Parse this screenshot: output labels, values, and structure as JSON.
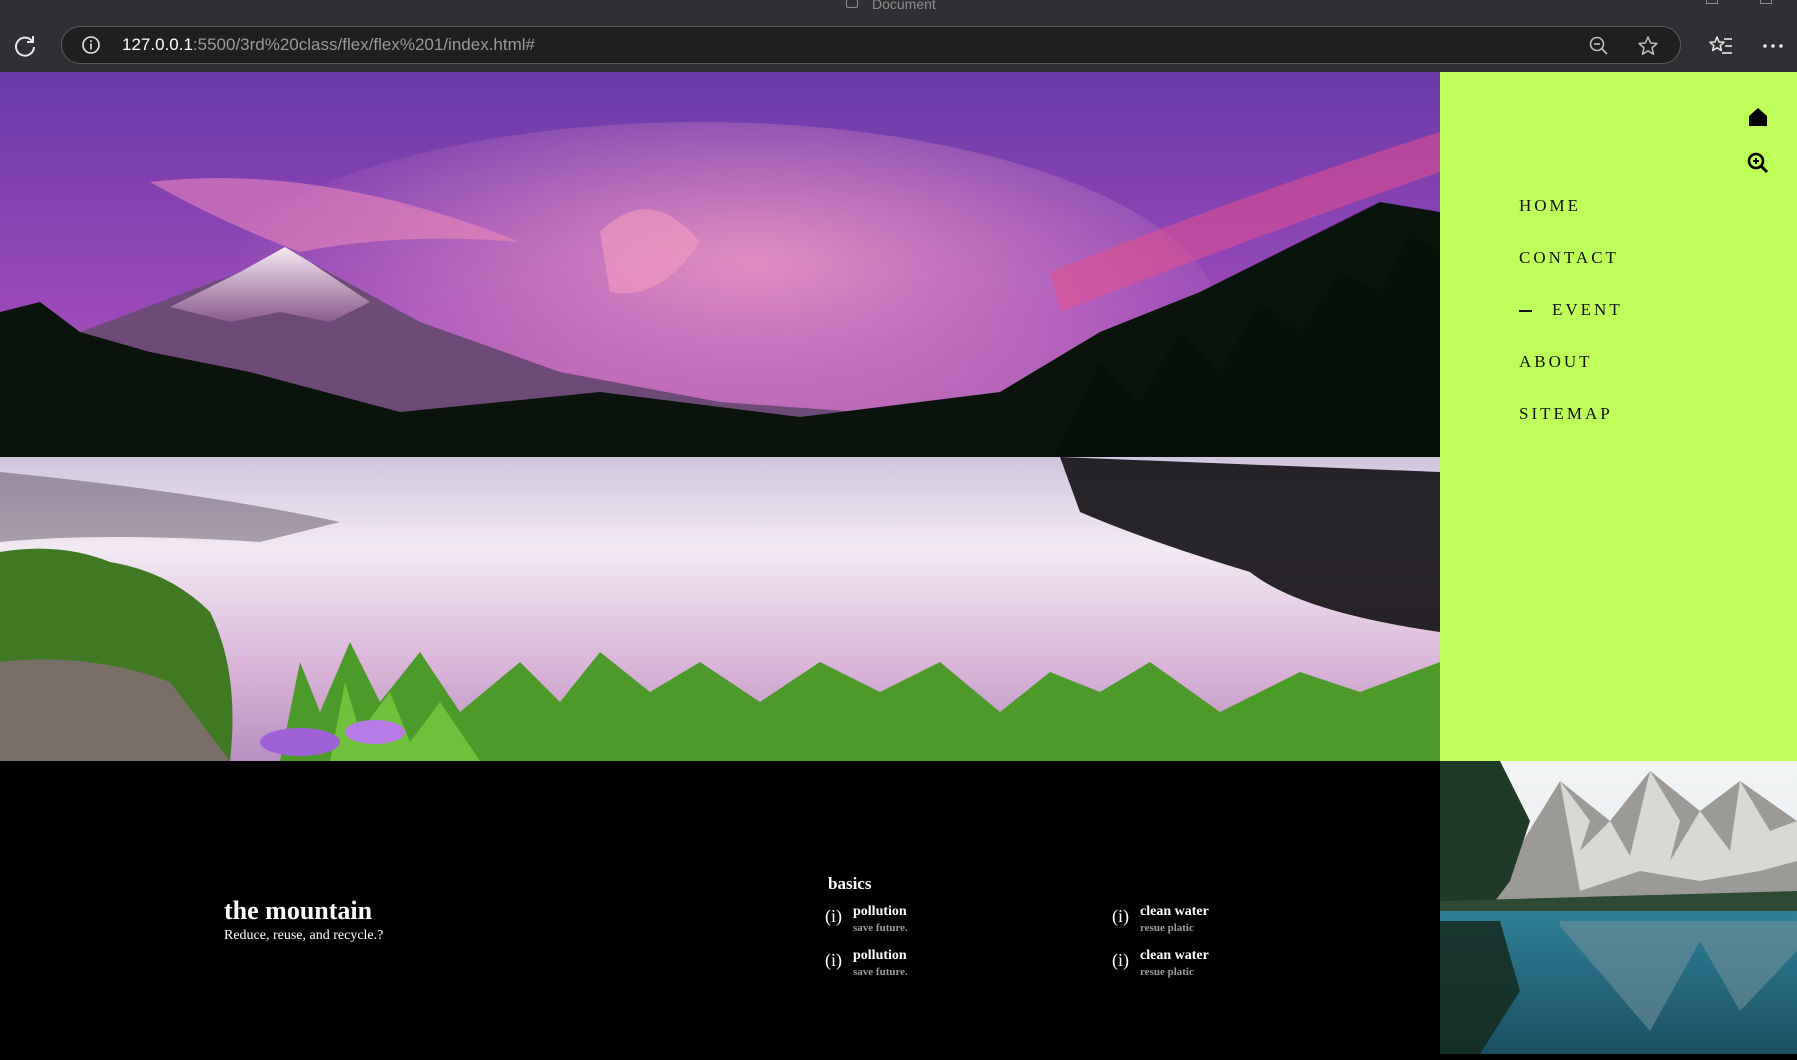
{
  "browser": {
    "tab_title": "Document",
    "url_host": "127.0.0.1",
    "url_rest": ":5500/3rd%20class/flex/flex%201/index.html#"
  },
  "sidebar": {
    "nav": [
      {
        "label": "HOME",
        "active": false
      },
      {
        "label": "CONTACT",
        "active": false
      },
      {
        "label": "EVENT",
        "active": true
      },
      {
        "label": "ABOUT",
        "active": false
      },
      {
        "label": "SITEMAP",
        "active": false
      }
    ],
    "icons": [
      "home-icon",
      "search-icon"
    ]
  },
  "footer": {
    "title": "the mountain",
    "subtitle": "Reduce, reuse, and recycle.?",
    "basics_heading": "basics",
    "items": [
      {
        "title": "pollution",
        "subtitle": "save future."
      },
      {
        "title": "clean water",
        "subtitle": "resue platic"
      },
      {
        "title": "pollution",
        "subtitle": "save future."
      },
      {
        "title": "clean water",
        "subtitle": "resue platic"
      }
    ],
    "info_glyph": "(i)"
  },
  "colors": {
    "sidebar_bg": "#bfff5a",
    "footer_bg": "#000000",
    "chrome_bg": "#2f3033"
  }
}
